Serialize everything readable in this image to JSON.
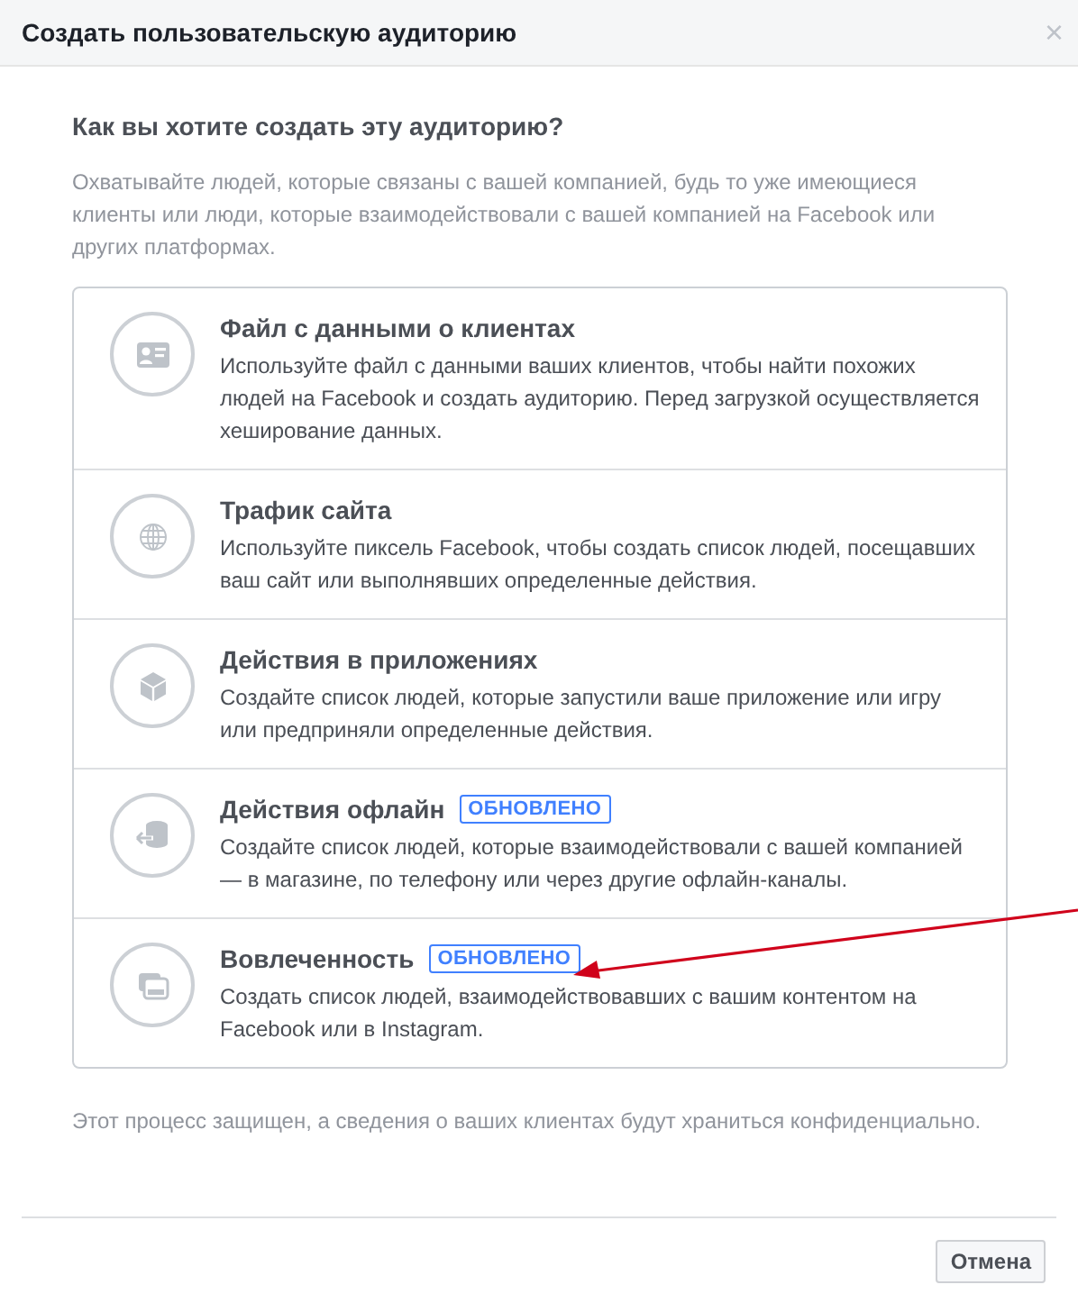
{
  "dialog": {
    "title": "Создать пользовательскую аудиторию",
    "close": "×"
  },
  "heading": "Как вы хотите создать эту аудиторию?",
  "intro": "Охватывайте людей, которые связаны с вашей компанией, будь то уже имеющиеся клиенты или люди, которые взаимодействовали с вашей компанией на Facebook или других платформах.",
  "options": [
    {
      "title": "Файл с данными о клиентах",
      "description": "Используйте файл с данными ваших клиентов, чтобы найти похожих людей на Facebook и создать аудиторию. Перед загрузкой осуществляется хеширование данных."
    },
    {
      "title": "Трафик сайта",
      "description": "Используйте пиксель Facebook, чтобы создать список людей, посещавших ваш сайт или выполнявших определенные действия."
    },
    {
      "title": "Действия в приложениях",
      "description": "Создайте список людей, которые запустили ваше приложение или игру или предприняли определенные действия."
    },
    {
      "title": "Действия офлайн",
      "badge": "ОБНОВЛЕНО",
      "description": "Создайте список людей, которые взаимодействовали с вашей компанией — в магазине, по телефону или через другие офлайн-каналы."
    },
    {
      "title": "Вовлеченность",
      "badge": "ОБНОВЛЕНО",
      "description": "Создать список людей, взаимодействовавших с вашим контентом на Facebook или в Instagram."
    }
  ],
  "note": "Этот процесс защищен, а сведения о ваших клиентах будут храниться конфиденциально.",
  "buttons": [
    "Отмена"
  ]
}
